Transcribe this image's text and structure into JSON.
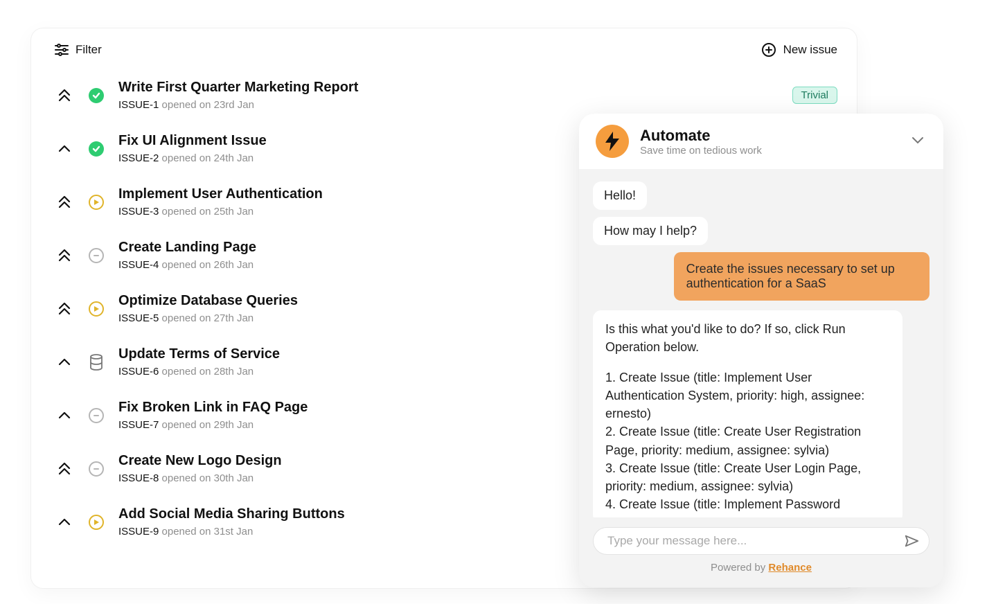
{
  "toolbar": {
    "filter_label": "Filter",
    "new_issue_label": "New issue"
  },
  "issues": [
    {
      "title": "Write First Quarter Marketing Report",
      "id": "ISSUE-1",
      "meta_rest": " opened on 23rd Jan",
      "priority": "double",
      "status": "green",
      "badge": "Trivial"
    },
    {
      "title": "Fix UI Alignment Issue",
      "id": "ISSUE-2",
      "meta_rest": " opened on 24th Jan",
      "priority": "single",
      "status": "green"
    },
    {
      "title": "Implement User Authentication",
      "id": "ISSUE-3",
      "meta_rest": " opened on 25th Jan",
      "priority": "double",
      "status": "play"
    },
    {
      "title": "Create Landing Page",
      "id": "ISSUE-4",
      "meta_rest": " opened on 26th Jan",
      "priority": "double",
      "status": "dash"
    },
    {
      "title": "Optimize Database Queries",
      "id": "ISSUE-5",
      "meta_rest": " opened on 27th Jan",
      "priority": "double",
      "status": "play"
    },
    {
      "title": "Update Terms of Service",
      "id": "ISSUE-6",
      "meta_rest": " opened on 28th Jan",
      "priority": "single",
      "status": "db"
    },
    {
      "title": "Fix Broken Link in FAQ Page",
      "id": "ISSUE-7",
      "meta_rest": " opened on 29th Jan",
      "priority": "single",
      "status": "dash"
    },
    {
      "title": "Create New Logo Design",
      "id": "ISSUE-8",
      "meta_rest": " opened on 30th Jan",
      "priority": "double",
      "status": "dash"
    },
    {
      "title": "Add Social Media Sharing Buttons",
      "id": "ISSUE-9",
      "meta_rest": " opened on 31st Jan",
      "priority": "single",
      "status": "play"
    }
  ],
  "chat": {
    "title": "Automate",
    "subtitle": "Save time on tedious work",
    "messages": {
      "bot1": "Hello!",
      "bot2": "How may I help?",
      "user1": "Create the issues necessary to set up authentication for a SaaS",
      "bot3_intro": "Is this what you'd like to do? If so, click Run Operation below.",
      "bot3_line1": "1. Create Issue (title: Implement User Authentication System, priority: high, assignee: ernesto)",
      "bot3_line2": "2. Create Issue (title: Create User Registration Page, priority: medium, assignee: sylvia)",
      "bot3_line3": "3. Create Issue (title: Create User Login Page, priority: medium, assignee: sylvia)",
      "bot3_line4": "4. Create Issue (title: Implement Password"
    },
    "input_placeholder": "Type your message here...",
    "powered_prefix": "Powered by ",
    "powered_link": "Rehance"
  }
}
